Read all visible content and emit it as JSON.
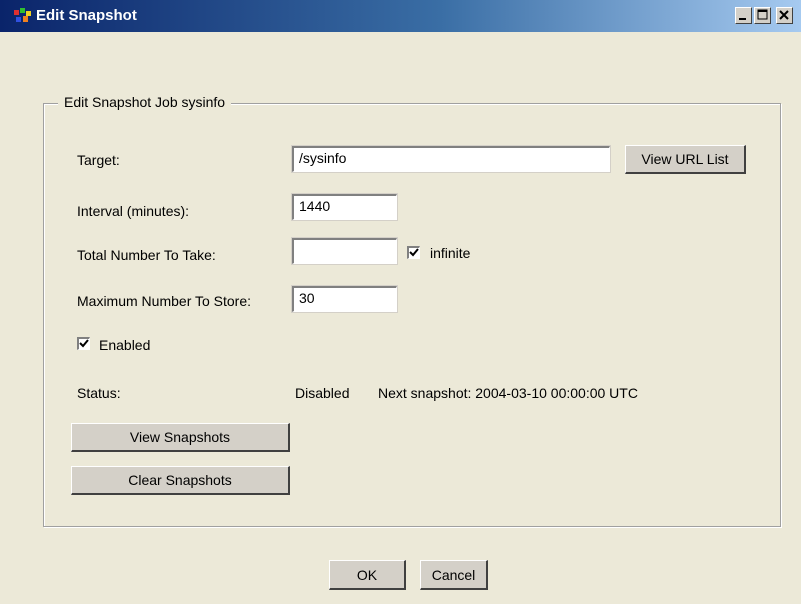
{
  "window": {
    "title": "Edit Snapshot"
  },
  "group": {
    "legend": "Edit Snapshot Job sysinfo"
  },
  "form": {
    "target": {
      "label": "Target:",
      "value": "/sysinfo"
    },
    "view_url_list_label": "View URL List",
    "interval": {
      "label": "Interval (minutes):",
      "value": "1440"
    },
    "total": {
      "label": "Total Number To Take:",
      "value": "",
      "infinite_label": "infinite",
      "infinite_checked": true
    },
    "max_store": {
      "label": "Maximum Number To Store:",
      "value": "30"
    },
    "enabled": {
      "label": "Enabled",
      "checked": true
    },
    "status": {
      "label": "Status:",
      "value": "Disabled",
      "next_snapshot": "Next snapshot: 2004-03-10 00:00:00 UTC"
    },
    "view_snapshots_label": "View Snapshots",
    "clear_snapshots_label": "Clear Snapshots"
  },
  "footer": {
    "ok_label": "OK",
    "cancel_label": "Cancel"
  }
}
